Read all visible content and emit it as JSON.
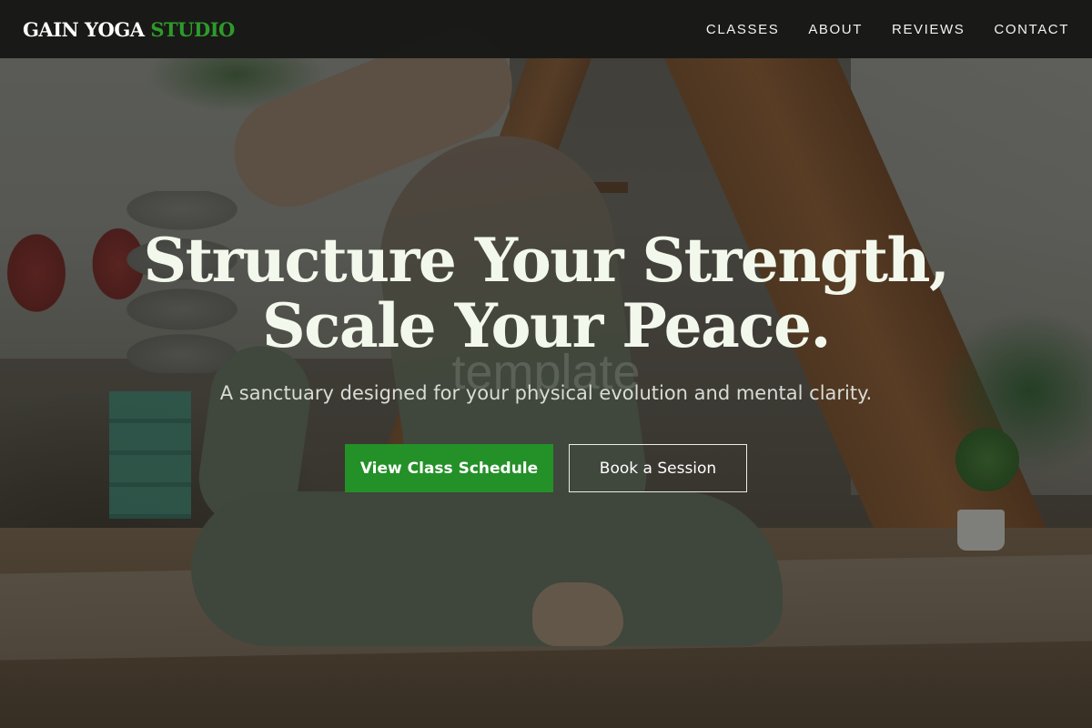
{
  "brand": {
    "name_primary": "GAIN YOGA",
    "name_accent": "STUDIO",
    "accent_color": "#2e9a2a"
  },
  "nav": {
    "items": [
      {
        "label": "CLASSES"
      },
      {
        "label": "ABOUT"
      },
      {
        "label": "REVIEWS"
      },
      {
        "label": "CONTACT"
      }
    ]
  },
  "hero": {
    "headline_line1": "Structure Your Strength,",
    "headline_line2": "Scale Your Peace.",
    "watermark": "template",
    "subtitle": "A sanctuary designed for your physical evolution and mental clarity.",
    "primary_cta": "View Class Schedule",
    "secondary_cta": "Book a Session",
    "primary_color": "#249028"
  }
}
